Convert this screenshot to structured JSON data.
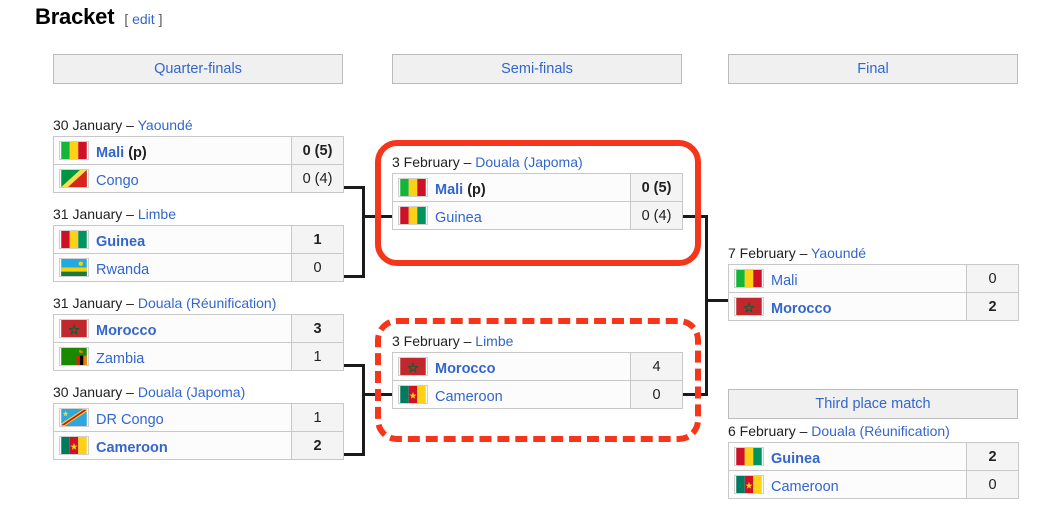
{
  "heading": {
    "title": "Bracket",
    "bracket_open": "[",
    "edit_label": "edit",
    "bracket_close": "]"
  },
  "rounds": {
    "quarter_finals": "Quarter-finals",
    "semi_finals": "Semi-finals",
    "final": "Final",
    "third_place": "Third place match"
  },
  "matches": {
    "qf1": {
      "date": "30 January",
      "dash": "–",
      "venue": "Yaoundé",
      "home": {
        "team": "Mali",
        "suffix": " (p)",
        "score": "0 (5)",
        "winner": true,
        "flag": "mali"
      },
      "away": {
        "team": "Congo",
        "suffix": "",
        "score": "0 (4)",
        "winner": false,
        "flag": "congo"
      }
    },
    "qf2": {
      "date": "31 January",
      "dash": "–",
      "venue": "Limbe",
      "home": {
        "team": "Guinea",
        "suffix": "",
        "score": "1",
        "winner": true,
        "flag": "guinea"
      },
      "away": {
        "team": "Rwanda",
        "suffix": "",
        "score": "0",
        "winner": false,
        "flag": "rwanda"
      }
    },
    "qf3": {
      "date": "31 January",
      "dash": "–",
      "venue": "Douala (Réunification)",
      "home": {
        "team": "Morocco",
        "suffix": "",
        "score": "3",
        "winner": true,
        "flag": "morocco"
      },
      "away": {
        "team": "Zambia",
        "suffix": "",
        "score": "1",
        "winner": false,
        "flag": "zambia"
      }
    },
    "qf4": {
      "date": "30 January",
      "dash": "–",
      "venue": "Douala (Japoma)",
      "home": {
        "team": "DR Congo",
        "suffix": "",
        "score": "1",
        "winner": false,
        "flag": "drcongo"
      },
      "away": {
        "team": "Cameroon",
        "suffix": "",
        "score": "2",
        "winner": true,
        "flag": "cameroon"
      }
    },
    "sf1": {
      "date": "3 February",
      "dash": "–",
      "venue": "Douala (Japoma)",
      "home": {
        "team": "Mali",
        "suffix": " (p)",
        "score": "0 (5)",
        "winner": true,
        "flag": "mali"
      },
      "away": {
        "team": "Guinea",
        "suffix": "",
        "score": "0 (4)",
        "winner": false,
        "flag": "guinea"
      }
    },
    "sf2": {
      "date": "3 February",
      "dash": "–",
      "venue": "Limbe",
      "home": {
        "team": "Morocco",
        "suffix": "",
        "score": "4",
        "winner": true,
        "flag": "morocco"
      },
      "away": {
        "team": "Cameroon",
        "suffix": "",
        "score": "0",
        "winner": false,
        "flag": "cameroon"
      }
    },
    "final": {
      "date": "7 February",
      "dash": "–",
      "venue": "Yaoundé",
      "home": {
        "team": "Mali",
        "suffix": "",
        "score": "0",
        "winner": false,
        "flag": "mali"
      },
      "away": {
        "team": "Morocco",
        "suffix": "",
        "score": "2",
        "winner": true,
        "flag": "morocco"
      }
    },
    "third": {
      "date": "6 February",
      "dash": "–",
      "venue": "Douala (Réunification)",
      "home": {
        "team": "Guinea",
        "suffix": "",
        "score": "2",
        "winner": true,
        "flag": "guinea"
      },
      "away": {
        "team": "Cameroon",
        "suffix": "",
        "score": "0",
        "winner": false,
        "flag": "cameroon"
      }
    }
  },
  "annotations": {
    "color": "#f5361b",
    "solid_target": "semi-final-1",
    "dashed_target": "semi-final-2"
  },
  "colors": {
    "link": "#3366cc",
    "header_bg": "#f0f0f0",
    "connector": "#1b1b1b"
  }
}
